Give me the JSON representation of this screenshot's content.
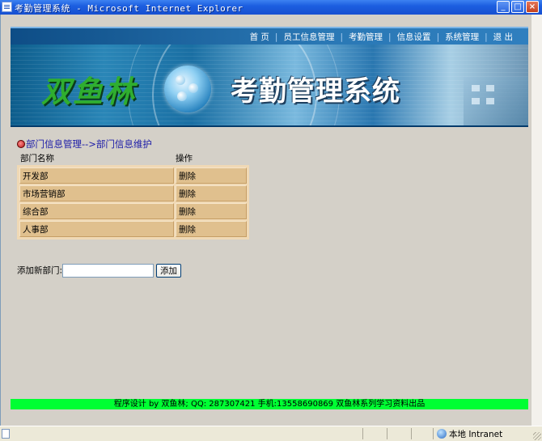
{
  "window": {
    "title": "考勤管理系统 - Microsoft Internet Explorer",
    "controls": {
      "minimize": "_",
      "maximize": "□",
      "close": "×"
    }
  },
  "nav": {
    "items": [
      {
        "label": "首 页"
      },
      {
        "label": "员工信息管理"
      },
      {
        "label": "考勤管理"
      },
      {
        "label": "信息设置"
      },
      {
        "label": "系统管理"
      },
      {
        "label": "退 出"
      }
    ],
    "separator": "|"
  },
  "banner": {
    "brand": "双鱼林",
    "system_title": "考勤管理系统",
    "colors": {
      "brand": "#2fae2f",
      "title": "#ffffff",
      "banner_base": "#1a6fa3"
    }
  },
  "breadcrumb": "部门信息管理-->部门信息维护",
  "table": {
    "headers": {
      "name": "部门名称",
      "action": "操作"
    },
    "rows": [
      {
        "name": "开发部",
        "action": "删除"
      },
      {
        "name": "市场营销部",
        "action": "删除"
      },
      {
        "name": "综合部",
        "action": "删除"
      },
      {
        "name": "人事部",
        "action": "删除"
      }
    ],
    "colors": {
      "cell": "#e0c08e",
      "border": "#f0d9b5"
    }
  },
  "add_form": {
    "label": "添加新部门:",
    "input_value": "",
    "button_label": "添加"
  },
  "footer": {
    "text": "程序设计 by 双鱼林; QQ: 287307421 手机:13558690869 双鱼林系列学习资料出品",
    "color": "#00ff33"
  },
  "statusbar": {
    "zone": "本地 Intranet"
  }
}
